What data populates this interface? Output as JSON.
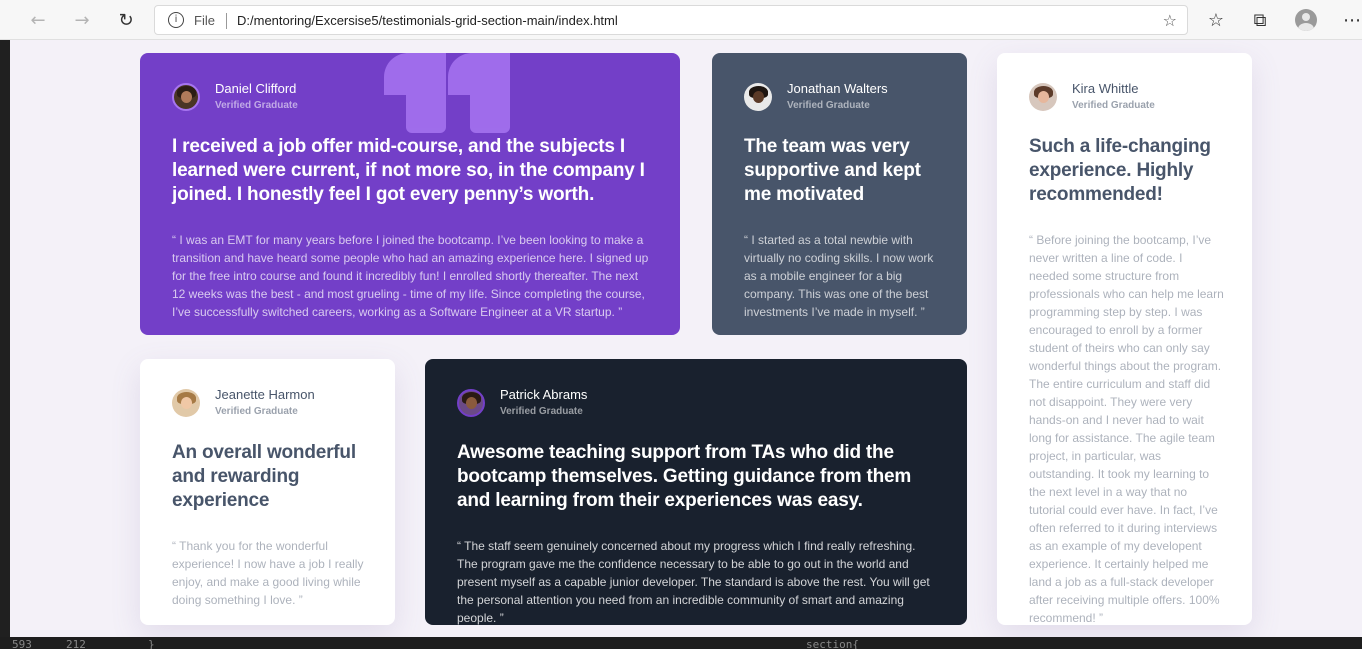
{
  "browser": {
    "scheme_label": "File",
    "url": "D:/mentoring/Excersise5/testimonials-grid-section-main/index.html",
    "icons": [
      "back-arrow-icon",
      "forward-arrow-icon",
      "refresh-icon",
      "info-icon",
      "add-favorite-icon",
      "favorites-icon",
      "collections-icon",
      "profile-avatar",
      "more-icon"
    ]
  },
  "testimonials": {
    "daniel": {
      "name": "Daniel Clifford",
      "role": "Verified Graduate",
      "quote": "I received a job offer mid-course, and the subjects I learned were current, if not more so, in the company I joined. I honestly feel I got every penny’s worth.",
      "body": "“ I was an EMT for many years before I joined the bootcamp. I’ve been looking to make a transition and have heard some people who had an amazing experience here. I signed up for the free intro course and found it incredibly fun! I enrolled shortly thereafter. The next 12 weeks was the best - and most grueling - time of my life. Since completing the course, I’ve successfully switched careers, working as a Software Engineer at a VR startup. ”"
    },
    "jonathan": {
      "name": "Jonathan Walters",
      "role": "Verified Graduate",
      "quote": "The team was very supportive and kept me motivated",
      "body": "“ I started as a total newbie with virtually no coding skills. I now work as a mobile engineer for a big company. This was one of the best investments I’ve made in myself. ”"
    },
    "kira": {
      "name": "Kira Whittle",
      "role": "Verified Graduate",
      "quote": "Such a life-changing experience. Highly recommended!",
      "body": "“ Before joining the bootcamp, I’ve never written a line of code. I needed some structure from professionals who can help me learn programming step by step. I was encouraged to enroll by a former student of theirs who can only say wonderful things about the program. The entire curriculum and staff did not disappoint. They were very hands-on and I never had to wait long for assistance. The agile team project, in particular, was outstanding. It took my learning to the next level in a way that no tutorial could ever have. In fact, I’ve often referred to it during interviews as an example of my developent experience. It certainly helped me land a job as a full-stack developer after receiving multiple offers. 100% recommend! ”"
    },
    "jeanette": {
      "name": "Jeanette Harmon",
      "role": "Verified Graduate",
      "quote": "An overall wonderful and rewarding experience",
      "body": "“ Thank you for the wonderful experience! I now have a job I really enjoy, and make a good living while doing something I love. ”"
    },
    "patrick": {
      "name": "Patrick Abrams",
      "role": "Verified Graduate",
      "quote": "Awesome teaching support from TAs who did the bootcamp themselves. Getting guidance from them and learning from their experiences was easy.",
      "body": "“ The staff seem genuinely concerned about my progress which I find really refreshing. The program gave me the confidence necessary to be able to go out in the world and present myself as a capable junior developer. The standard is above the rest. You will get the personal attention you need from an incredible community of smart and amazing people. ”"
    }
  },
  "editor": {
    "line_a": "593",
    "line_b": "212",
    "code_a": "}",
    "code_b": "section{"
  },
  "colors": {
    "purple": "#733fc8",
    "slate": "#48556a",
    "dark": "#19212e",
    "background": "#f4f1f8"
  }
}
